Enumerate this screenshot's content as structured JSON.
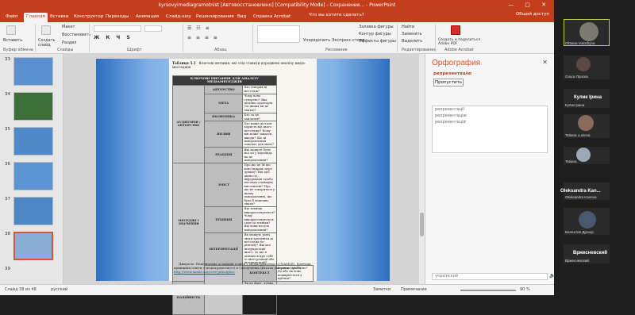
{
  "window": {
    "title": "kyrsovyimediagramotnist [Автовосстановлено] [Compatibility Mode] - Сохранение... - PowerPoint",
    "controls": "— ▢ ✕"
  },
  "tabs": [
    "Файл",
    "Главная",
    "Вставка",
    "Конструктор",
    "Переходы",
    "Анимация",
    "Слайд-шоу",
    "Рецензирование",
    "Вид",
    "Справка",
    "Acrobat"
  ],
  "active_tab": 1,
  "tell_me": "Что вы хотите сделать?",
  "share_label": "Общий доступ",
  "ribbon": {
    "paste": "Вставить",
    "clipboard": "Буфер обмена",
    "new_slide": "Создать слайд",
    "layout": "Макет",
    "reset": "Восстановить",
    "section": "Раздел",
    "slides": "Слайды",
    "font": "Шрифт",
    "paragraph": "Абзац",
    "arrange": "Упорядочить",
    "quick_styles": "Экспресс-стили",
    "shape_fill": "Заливка фигуры",
    "shape_outline": "Контур фигуры",
    "shape_effects": "Эффекты фигуры",
    "drawing": "Рисование",
    "find": "Найти",
    "replace": "Заменить",
    "select": "Выделить",
    "editing": "Редактирование",
    "acrobat_share": "Создать и поделиться Adobe PDF",
    "adobe_acrobat": "Adobe Acrobat"
  },
  "thumbnails": [
    {
      "num": "33",
      "color": "#5a8fd0"
    },
    {
      "num": "34",
      "color": "#3e6f3a"
    },
    {
      "num": "35",
      "color": "#4f89c9"
    },
    {
      "num": "36",
      "color": "#5b93d3"
    },
    {
      "num": "37",
      "color": "#4d86c6"
    },
    {
      "num": "38",
      "color": "#8aaed8"
    },
    {
      "num": "39",
      "color": ""
    }
  ],
  "slide": {
    "caption_label": "Таблиця 5.1",
    "caption": "Ключові питання, які слід ставити породжені аналізу медіа-месседжів",
    "table_header": "КЛЮЧОВІ ПИТАННЯ ДЛЯ АНАЛІЗУ МЕДІАМЕСЕДЖІВ",
    "rows": [
      {
        "cat": "АУДИТОРІЯ / АВТОРСТВО",
        "span": 5,
        "sub": "АВТОРСТВО",
        "q": "Хто створив ці месседж?"
      },
      {
        "sub": "МЕТА",
        "q": "Чому воно створено? Яка цільова аудиторія (та інших ви це знати)?"
      },
      {
        "sub": "ЕКОНОМІКА",
        "q": "Хто за це заплатив?"
      },
      {
        "sub": "ВПЛИВ",
        "q": "Хто може дістати користь від цього месседжу? Кому він може завдати шкоди? Що ці повідомлення означає для мене?"
      },
      {
        "sub": "РЕАКЦІЯ",
        "q": "Які можуть бути мої дії у відповідь на це повідомлення?"
      },
      {
        "cat": "МЕСЕДЖІ І ЗНАЧЕННЯ",
        "span": 4,
        "sub": "ЗМІСТ",
        "q": "Про що це (й що воно ширше пере думки)? Які ідеї, цінності, інформація та/або погляди очевидні/висловлені? Про що не говориться у цьому повідомленні, що буде б важливо знати?"
      },
      {
        "sub": "ТЕХНІКИ",
        "q": "Які техніки використовуються? Чому використовуються саме ці техніки? Які вони несуть повідомлення?"
      },
      {
        "sub": "ІНТЕРПРЕТАЦІЇ",
        "q": "Як можуть різні люди зрозуміти ці месседжі по-різному? Які мої інтерпретації цього, та що я дізнаюся про себе зі своєї реакції або інтерпретації?"
      },
      {
        "cat": "ПРЕДСТАВЛЕНІСТЬ РЕАЛЬНІСТЬ",
        "span": 2,
        "sub": "КОНТЕКСТ",
        "q": "Коли це зроблено? Де або як воно поширюється у публіці?"
      },
      {
        "sub": "НАДІЙНІСТЬ",
        "q": "Чи це факт, думка, чи щось інше? Наскільки надійне джерело (та що підтверджує цю думку)? Які джерела інформації, думок, припущень?"
      }
    ],
    "footnote": "Джерело: Національна асоціація освіти з медіаграмотності (NAMLE). Ключові принципи освіти з медіаграмотності в Сполучених Штатах Америки (2007).",
    "footnote_link": "http://www.namle.net/core-principles/"
  },
  "spellcheck": {
    "title": "Орфография",
    "close": "✕",
    "word": "репрезентацію",
    "skip_button": "Пропустить",
    "suggestions": [
      "репрезентації",
      "репрезентацію",
      "репрезентацій"
    ],
    "bottom_word": "українский",
    "bottom_icon": "🔈"
  },
  "statusbar": {
    "slide": "Слайд 38 из 48",
    "language": "русский",
    "notes": "Заметки",
    "comments": "Примечания",
    "zoom": "90 %"
  },
  "participants": {
    "tiles": [
      {
        "name": "Oksana Voloshyna",
        "color": "#7a7a6e"
      },
      {
        "name": "Ольга Проска",
        "color": "#5c4a40"
      },
      {
        "name": "Кулик Ірина",
        "color": "#6a6a6a"
      },
      {
        "name": "Tetiana Lunieva",
        "color": "#8a6a5a"
      },
      {
        "name": "Tetiana",
        "color": "#9aa8b8"
      },
      {
        "name": "Oleksandra Kaneva",
        "color": ""
      },
      {
        "name": "Валентин Дронус",
        "color": "#4a5870"
      },
      {
        "name": "Вржесневский",
        "color": ""
      }
    ],
    "big_names": [
      "Кулик Ірина",
      "Oleksandra Kan...",
      "Вржесневский"
    ]
  }
}
